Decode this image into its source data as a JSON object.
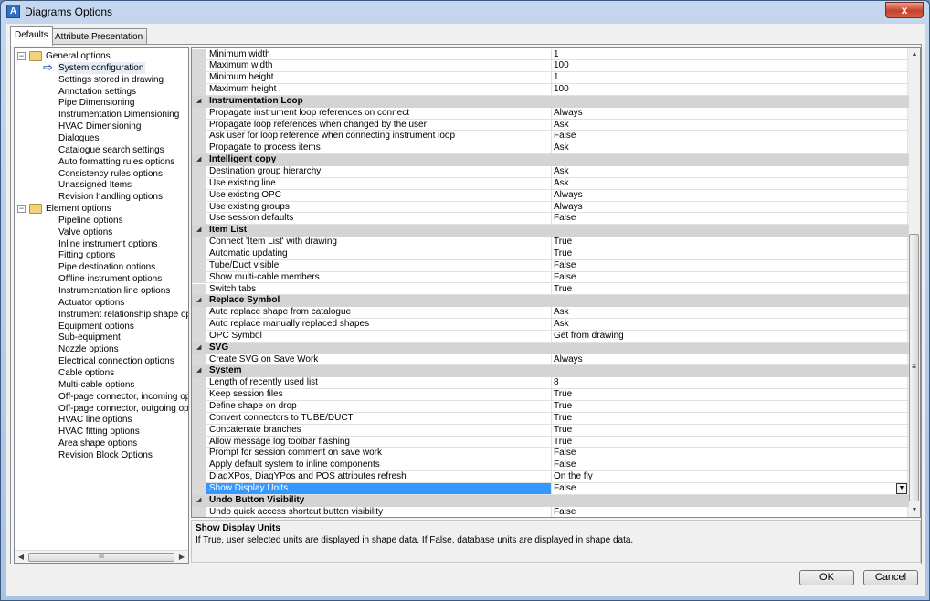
{
  "window": {
    "title": "Diagrams Options",
    "icon_letter": "A",
    "close_label": "x"
  },
  "tabs": [
    {
      "label": "Defaults"
    },
    {
      "label": "Attribute Presentation"
    }
  ],
  "tree": {
    "groups": [
      {
        "label": "General options",
        "expander": "−",
        "items": [
          "System configuration",
          "Settings stored in drawing",
          "Annotation settings",
          "Pipe Dimensioning",
          "Instrumentation Dimensioning",
          "HVAC Dimensioning",
          "Dialogues",
          "Catalogue search settings",
          "Auto formatting rules options",
          "Consistency rules options",
          "Unassigned Items",
          "Revision handling options"
        ]
      },
      {
        "label": "Element options",
        "expander": "−",
        "items": [
          "Pipeline options",
          "Valve options",
          "Inline instrument options",
          "Fitting options",
          "Pipe destination options",
          "Offline instrument options",
          "Instrumentation line options",
          "Actuator options",
          "Instrument relationship shape options",
          "Equipment options",
          "Sub-equipment",
          "Nozzle options",
          "Electrical connection options",
          "Cable options",
          "Multi-cable options",
          "Off-page connector, incoming options",
          "Off-page connector, outgoing options",
          "HVAC line options",
          "HVAC fitting options",
          "Area shape options",
          "Revision Block Options"
        ]
      }
    ],
    "selected": "System configuration",
    "hscroll_grip": "III"
  },
  "grid": {
    "rows": [
      {
        "name": "Minimum width",
        "value": "1"
      },
      {
        "name": "Maximum width",
        "value": "100"
      },
      {
        "name": "Minimum height",
        "value": "1"
      },
      {
        "name": "Maximum height",
        "value": "100"
      },
      {
        "category": "Instrumentation Loop"
      },
      {
        "name": "Propagate instrument loop references on connect",
        "value": "Always"
      },
      {
        "name": "Propagate loop references when changed by the user",
        "value": "Ask"
      },
      {
        "name": "Ask user for loop reference when connecting instrument loop",
        "value": "False"
      },
      {
        "name": "Propagate to process items",
        "value": "Ask"
      },
      {
        "category": "Intelligent copy"
      },
      {
        "name": "Destination group hierarchy",
        "value": "Ask"
      },
      {
        "name": "Use existing line",
        "value": "Ask"
      },
      {
        "name": "Use existing OPC",
        "value": "Always"
      },
      {
        "name": "Use existing groups",
        "value": "Always"
      },
      {
        "name": "Use session defaults",
        "value": "False"
      },
      {
        "category": "Item List"
      },
      {
        "name": "Connect 'Item List' with drawing",
        "value": "True"
      },
      {
        "name": "Automatic updating",
        "value": "True"
      },
      {
        "name": "Tube/Duct visible",
        "value": "False"
      },
      {
        "name": "Show multi-cable members",
        "value": "False"
      },
      {
        "name": "Switch tabs",
        "value": "True"
      },
      {
        "category": "Replace Symbol"
      },
      {
        "name": "Auto replace shape from catalogue",
        "value": "Ask"
      },
      {
        "name": "Auto replace manually replaced shapes",
        "value": "Ask"
      },
      {
        "name": "OPC Symbol",
        "value": "Get from drawing"
      },
      {
        "category": "SVG"
      },
      {
        "name": "Create SVG on Save Work",
        "value": "Always"
      },
      {
        "category": "System"
      },
      {
        "name": "Length of recently used list",
        "value": "8"
      },
      {
        "name": "Keep session files",
        "value": "True"
      },
      {
        "name": "Define shape on drop",
        "value": "True"
      },
      {
        "name": "Convert connectors to TUBE/DUCT",
        "value": "True"
      },
      {
        "name": "Concatenate branches",
        "value": "True"
      },
      {
        "name": "Allow message log toolbar flashing",
        "value": "True"
      },
      {
        "name": "Prompt for session comment on save work",
        "value": "False"
      },
      {
        "name": "Apply default system to inline components",
        "value": "False"
      },
      {
        "name": "DiagXPos, DiagYPos and POS attributes refresh",
        "value": "On the fly"
      },
      {
        "name": "Show Display Units",
        "value": "False",
        "selected": true
      },
      {
        "category": "Undo Button Visibility"
      },
      {
        "name": "Undo quick access shortcut button visibility",
        "value": "False"
      }
    ]
  },
  "description": {
    "title": "Show Display Units",
    "text": "If True, user selected units are displayed in shape data. If False, database units are displayed in shape data."
  },
  "buttons": {
    "ok": "OK",
    "cancel": "Cancel"
  }
}
